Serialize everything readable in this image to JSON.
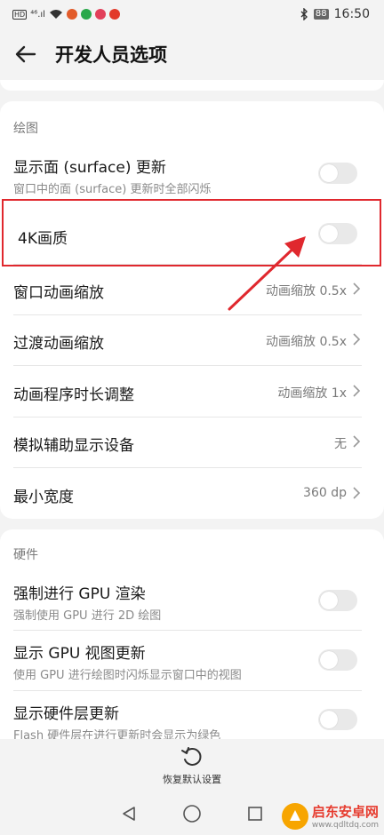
{
  "status_bar": {
    "hd_label": "HD",
    "signal": "⁴⁶.ıl",
    "battery": "88",
    "time": "16:50"
  },
  "header": {
    "title": "开发人员选项"
  },
  "section_drawing": {
    "title": "绘图",
    "rows": [
      {
        "title": "显示面 (surface) 更新",
        "subtitle": "窗口中的面 (surface) 更新时全部闪烁",
        "control": "toggle"
      },
      {
        "title": "4K画质",
        "control": "toggle"
      },
      {
        "title": "窗口动画缩放",
        "value": "动画缩放 0.5x"
      },
      {
        "title": "过渡动画缩放",
        "value": "动画缩放 0.5x"
      },
      {
        "title": "动画程序时长调整",
        "value": "动画缩放 1x"
      },
      {
        "title": "模拟辅助显示设备",
        "value": "无"
      },
      {
        "title": "最小宽度",
        "value": "360 dp"
      }
    ]
  },
  "section_hardware": {
    "title": "硬件",
    "rows": [
      {
        "title": "强制进行 GPU 渲染",
        "subtitle": "强制使用 GPU 进行 2D 绘图"
      },
      {
        "title": "显示 GPU 视图更新",
        "subtitle": "使用 GPU 进行绘图时闪烁显示窗口中的视图"
      },
      {
        "title": "显示硬件层更新",
        "subtitle": "Flash 硬件层在进行更新时会显示为绿色"
      }
    ]
  },
  "restore": {
    "label": "恢复默认设置"
  },
  "watermark": {
    "name": "启东安卓网",
    "url": "www.qdltdq.com"
  },
  "colors": {
    "highlight": "#e0282e",
    "accent_orange": "#f7a500"
  }
}
